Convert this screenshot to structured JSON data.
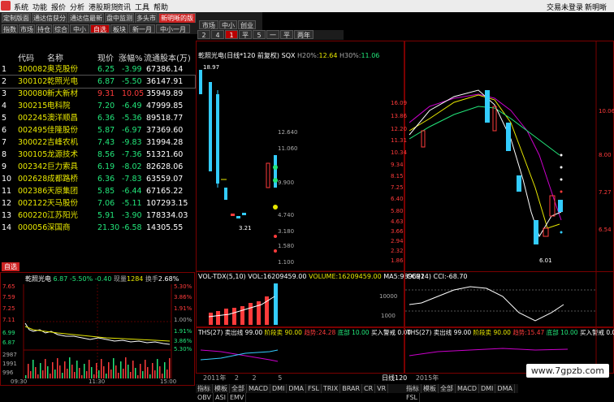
{
  "menu": {
    "items": [
      "系统",
      "功能",
      "报价",
      "分析",
      "港股期货",
      "资讯",
      "工具",
      "帮助"
    ],
    "right_text": "交易未登录",
    "right_app": "新明晰"
  },
  "tabs_top": [
    "定制版面",
    "通达信获分",
    "通达信最新盘",
    "盘中监测",
    "多头市",
    "新明晰的版"
  ],
  "tabs_top_active": 5,
  "tabs_sub": [
    "指数",
    "市场",
    "持仓",
    "综合",
    "中小",
    "自选",
    "板块",
    "新一月",
    "中小一月"
  ],
  "tabs_sub_active": 5,
  "tabs_right": [
    "市场",
    "中小",
    "创业"
  ],
  "tabs_right2": [
    "2",
    "4",
    "1",
    "平",
    "5",
    "一",
    "平",
    "两年"
  ],
  "list_header": {
    "code": "代码",
    "name": "名称",
    "price": "现价",
    "change": "涨幅%",
    "float": "流通股本(万)"
  },
  "stocks": [
    {
      "idx": "1",
      "code": "300082",
      "name": "奥克股份",
      "price": "6.25",
      "chg": "-3.99",
      "float": "67386.14"
    },
    {
      "idx": "2",
      "code": "300102",
      "name": "乾照光电",
      "price": "6.87",
      "chg": "-5.50",
      "float": "36147.91"
    },
    {
      "idx": "3",
      "code": "300080",
      "name": "新大新材",
      "price": "9.31",
      "chg": "10.05",
      "float": "35949.89"
    },
    {
      "idx": "4",
      "code": "300215",
      "name": "电科院",
      "price": "7.20",
      "chg": "-6.49",
      "float": "47999.85"
    },
    {
      "idx": "5",
      "code": "002245",
      "name": "澳洋顺昌",
      "price": "6.36",
      "chg": "-5.36",
      "float": "89518.77"
    },
    {
      "idx": "6",
      "code": "002495",
      "name": "佳隆股份",
      "price": "5.87",
      "chg": "-6.97",
      "float": "37369.60"
    },
    {
      "idx": "7",
      "code": "300022",
      "name": "吉峰农机",
      "price": "7.43",
      "chg": "-9.83",
      "float": "31994.28"
    },
    {
      "idx": "8",
      "code": "300105",
      "name": "龙源技术",
      "price": "8.56",
      "chg": "-7.36",
      "float": "51321.60"
    },
    {
      "idx": "9",
      "code": "002342",
      "name": "巨力索具",
      "price": "6.19",
      "chg": "-8.02",
      "float": "82628.06"
    },
    {
      "idx": "10",
      "code": "002628",
      "name": "成都路桥",
      "price": "6.36",
      "chg": "-7.83",
      "float": "63559.07"
    },
    {
      "idx": "11",
      "code": "002386",
      "name": "天原集团",
      "price": "5.85",
      "chg": "-6.44",
      "float": "67165.22"
    },
    {
      "idx": "12",
      "code": "002122",
      "name": "天马股份",
      "price": "7.06",
      "chg": "-5.11",
      "float": "107293.15"
    },
    {
      "idx": "13",
      "code": "600220",
      "name": "江苏阳光",
      "price": "5.91",
      "chg": "-3.90",
      "float": "178334.03"
    },
    {
      "idx": "14",
      "code": "000056",
      "name": "深国商",
      "price": "21.30",
      "chg": "-6.58",
      "float": "14305.55"
    }
  ],
  "zixuan_label": "自选",
  "intraday": {
    "title": "乾照光电",
    "price": "6.87",
    "pct": "-5.50%",
    "delta": "-0.40",
    "vol_label": "现量",
    "vol": "1284",
    "turnover_label": "换手",
    "turnover": "2.68%",
    "left_scale": [
      "7.65",
      "7.59",
      "7.25",
      "7.11",
      "6.99",
      "6.87",
      "2987",
      "1991",
      "996"
    ],
    "right_scale": [
      "5.30%",
      "3.86%",
      "1.91%",
      "1.00%",
      "1.91%",
      "3.86%",
      "5.30%"
    ],
    "times": [
      "09:30",
      "11:30",
      "15:00"
    ]
  },
  "kline1": {
    "title": "乾照光电(日线*120 前复权)",
    "sqx": "SQX",
    "h20_label": "H20%:",
    "h20": "12.64",
    "h30_label": "H30%:",
    "h30": "11.06",
    "price_labels": [
      "18.97",
      "12.640",
      "11.060",
      "9.900",
      "4.740",
      "3.180",
      "1.580",
      "1.100",
      "3.21"
    ],
    "vol_title": "VOL-TDX(5,10)",
    "vol_label": "VOL:",
    "vol_value": "16209459.00",
    "volume_label": "VOLUME:",
    "volume_value": "16209459.00",
    "ma5_label": "MA5:",
    "ma5_value": "989692",
    "ths_title": "THS(27)",
    "ths_sell": "卖出线",
    "ths_sell_val": "99.00",
    "ths_stage": "阶段卖",
    "ths_stage_val": "90.00",
    "ths_trend": "趋势:",
    "ths_trend_val": "24.28",
    "ths_bottom": "底部",
    "ths_bottom_val": "10.00",
    "ths_buy": "买入警戒",
    "ths_buy_val": "0.00",
    "year_label": "2011年",
    "date_ticks": [
      "2",
      "2",
      "5"
    ]
  },
  "kline2": {
    "scale": [
      "16.09",
      "13.86",
      "12.20",
      "11.31",
      "10.34",
      "9.34",
      "8.15",
      "7.25",
      "6.40",
      "5.80",
      "4.63",
      "3.66",
      "2.94",
      "2.32",
      "1.86",
      "6.01"
    ],
    "right_scale": [
      "10.06",
      "8.00",
      "7.27",
      "6.54"
    ],
    "cci_title": "CCI(14)",
    "cci_label": "CCI:",
    "cci_value": "-68.70",
    "cci_levels": [
      "10000",
      "1000"
    ],
    "ths_title": "THS(27)",
    "ths_sell": "卖出线",
    "ths_sell_val": "99.00",
    "ths_stage": "阶段卖",
    "ths_stage_val": "90.00",
    "ths_trend": "趋势:",
    "ths_trend_val": "15.47",
    "ths_bottom": "底部",
    "ths_bottom_val": "10.00",
    "ths_buy": "买入警戒",
    "ths_buy_val": "0.00",
    "year_label": "2015年",
    "right_label": "日线",
    "right_label2": "120"
  },
  "bottom_tabs": [
    "指标",
    "模板",
    "全部",
    "MACD",
    "DMI",
    "DMA",
    "FSL",
    "TRIX",
    "BRAR",
    "CR",
    "VR",
    "OBV",
    "ASI",
    "EMV"
  ],
  "bottom_tabs2": [
    "指标",
    "模板",
    "全部",
    "MACD",
    "DMI",
    "DMA",
    "FSL"
  ],
  "watermark": "www.7gpzb.com",
  "colors": {
    "up": "#ff3b3b",
    "down": "#22e67a",
    "accent": "#c22",
    "bg": "#000000"
  }
}
